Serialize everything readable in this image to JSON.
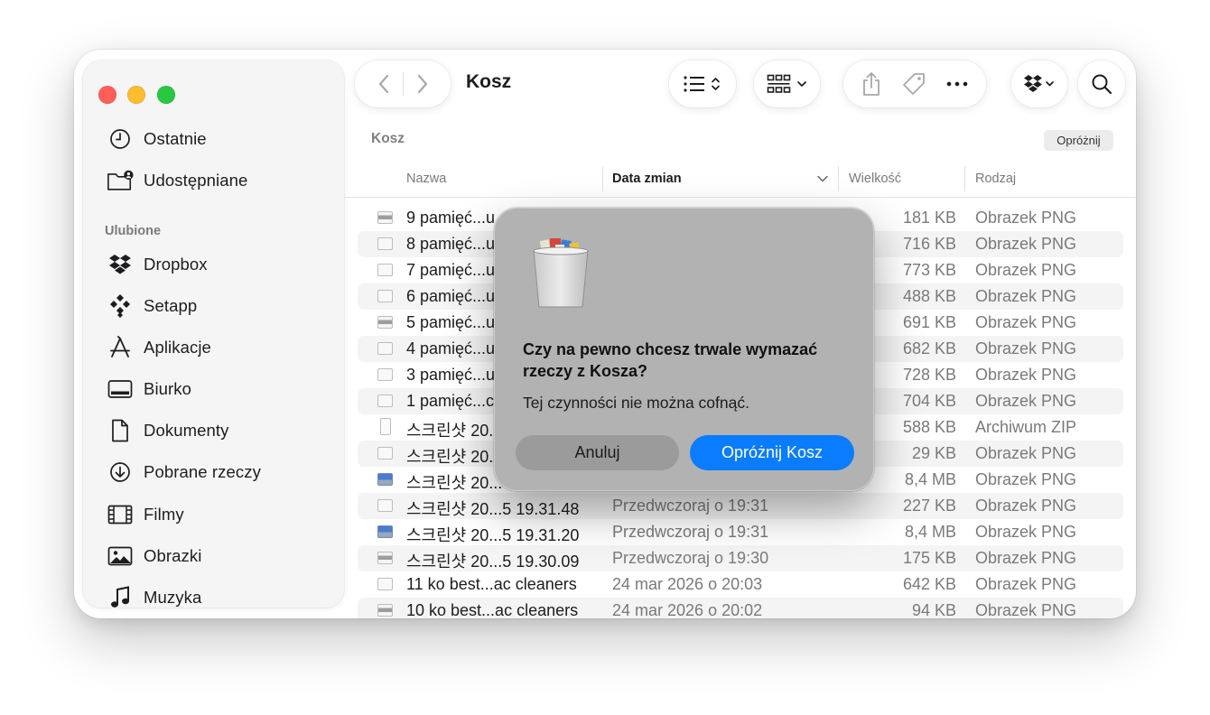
{
  "window": {
    "title": "Kosz"
  },
  "sidebar": {
    "items_top": [
      {
        "label": "Ostatnie",
        "icon": "clock-icon"
      },
      {
        "label": "Udostępniane",
        "icon": "shared-folder-icon"
      }
    ],
    "section_title": "Ulubione",
    "favorites": [
      {
        "label": "Dropbox",
        "icon": "dropbox-icon"
      },
      {
        "label": "Setapp",
        "icon": "setapp-icon"
      },
      {
        "label": "Aplikacje",
        "icon": "applications-icon"
      },
      {
        "label": "Biurko",
        "icon": "desktop-icon"
      },
      {
        "label": "Dokumenty",
        "icon": "document-icon"
      },
      {
        "label": "Pobrane rzeczy",
        "icon": "download-icon"
      },
      {
        "label": "Filmy",
        "icon": "film-icon"
      },
      {
        "label": "Obrazki",
        "icon": "picture-icon"
      },
      {
        "label": "Muzyka",
        "icon": "music-note-icon"
      }
    ]
  },
  "content": {
    "path_label": "Kosz",
    "empty_button": "Opróżnij",
    "columns": {
      "name": "Nazwa",
      "date": "Data zmian",
      "size": "Wielkość",
      "kind": "Rodzaj"
    },
    "rows": [
      {
        "name": "9 pamięć...u",
        "date": "",
        "size": "181 KB",
        "kind": "Obrazek PNG",
        "thumb": "gray"
      },
      {
        "name": "8 pamięć...u",
        "date": "",
        "size": "716 KB",
        "kind": "Obrazek PNG",
        "thumb": "plain"
      },
      {
        "name": "7 pamięć...u",
        "date": "",
        "size": "773 KB",
        "kind": "Obrazek PNG",
        "thumb": "plain"
      },
      {
        "name": "6 pamięć...u",
        "date": "",
        "size": "488 KB",
        "kind": "Obrazek PNG",
        "thumb": "plain"
      },
      {
        "name": "5 pamięć...u",
        "date": "",
        "size": "691 KB",
        "kind": "Obrazek PNG",
        "thumb": "gray"
      },
      {
        "name": "4 pamięć...u",
        "date": "",
        "size": "682 KB",
        "kind": "Obrazek PNG",
        "thumb": "plain"
      },
      {
        "name": "3 pamięć...u",
        "date": "",
        "size": "728 KB",
        "kind": "Obrazek PNG",
        "thumb": "plain"
      },
      {
        "name": "1 pamięć...c",
        "date": "",
        "size": "704 KB",
        "kind": "Obrazek PNG",
        "thumb": "plain"
      },
      {
        "name": "스크린샷 20...",
        "date": "",
        "size": "588 KB",
        "kind": "Archiwum ZIP",
        "thumb": "zip"
      },
      {
        "name": "스크린샷 20...",
        "date": "",
        "size": "29 KB",
        "kind": "Obrazek PNG",
        "thumb": "plain"
      },
      {
        "name": "스크린샷 20...",
        "date": "",
        "size": "8,4 MB",
        "kind": "Obrazek PNG",
        "thumb": "blue"
      },
      {
        "name": "스크린샷 20...5 19.31.48",
        "date": "Przedwczoraj o 19:31",
        "size": "227 KB",
        "kind": "Obrazek PNG",
        "thumb": "plain"
      },
      {
        "name": "스크린샷 20...5 19.31.20",
        "date": "Przedwczoraj o 19:31",
        "size": "8,4 MB",
        "kind": "Obrazek PNG",
        "thumb": "blue"
      },
      {
        "name": "스크린샷 20...5 19.30.09",
        "date": "Przedwczoraj o 19:30",
        "size": "175 KB",
        "kind": "Obrazek PNG",
        "thumb": "gray"
      },
      {
        "name": "11 ko best...ac cleaners",
        "date": "24 mar 2026 o 20:03",
        "size": "642 KB",
        "kind": "Obrazek PNG",
        "thumb": "plain"
      },
      {
        "name": "10 ko best...ac cleaners",
        "date": "24 mar 2026 o 20:02",
        "size": "94 KB",
        "kind": "Obrazek PNG",
        "thumb": "gray"
      }
    ]
  },
  "dialog": {
    "question": "Czy na pewno chcesz trwale wymazać rzeczy z Kosza?",
    "info": "Tej czynności nie można cofnąć.",
    "cancel_label": "Anuluj",
    "confirm_label": "Opróżnij Kosz"
  },
  "colors": {
    "accent": "#0a7cff",
    "close": "#ff5f57",
    "minimize": "#febc2e",
    "zoom": "#28c840"
  }
}
